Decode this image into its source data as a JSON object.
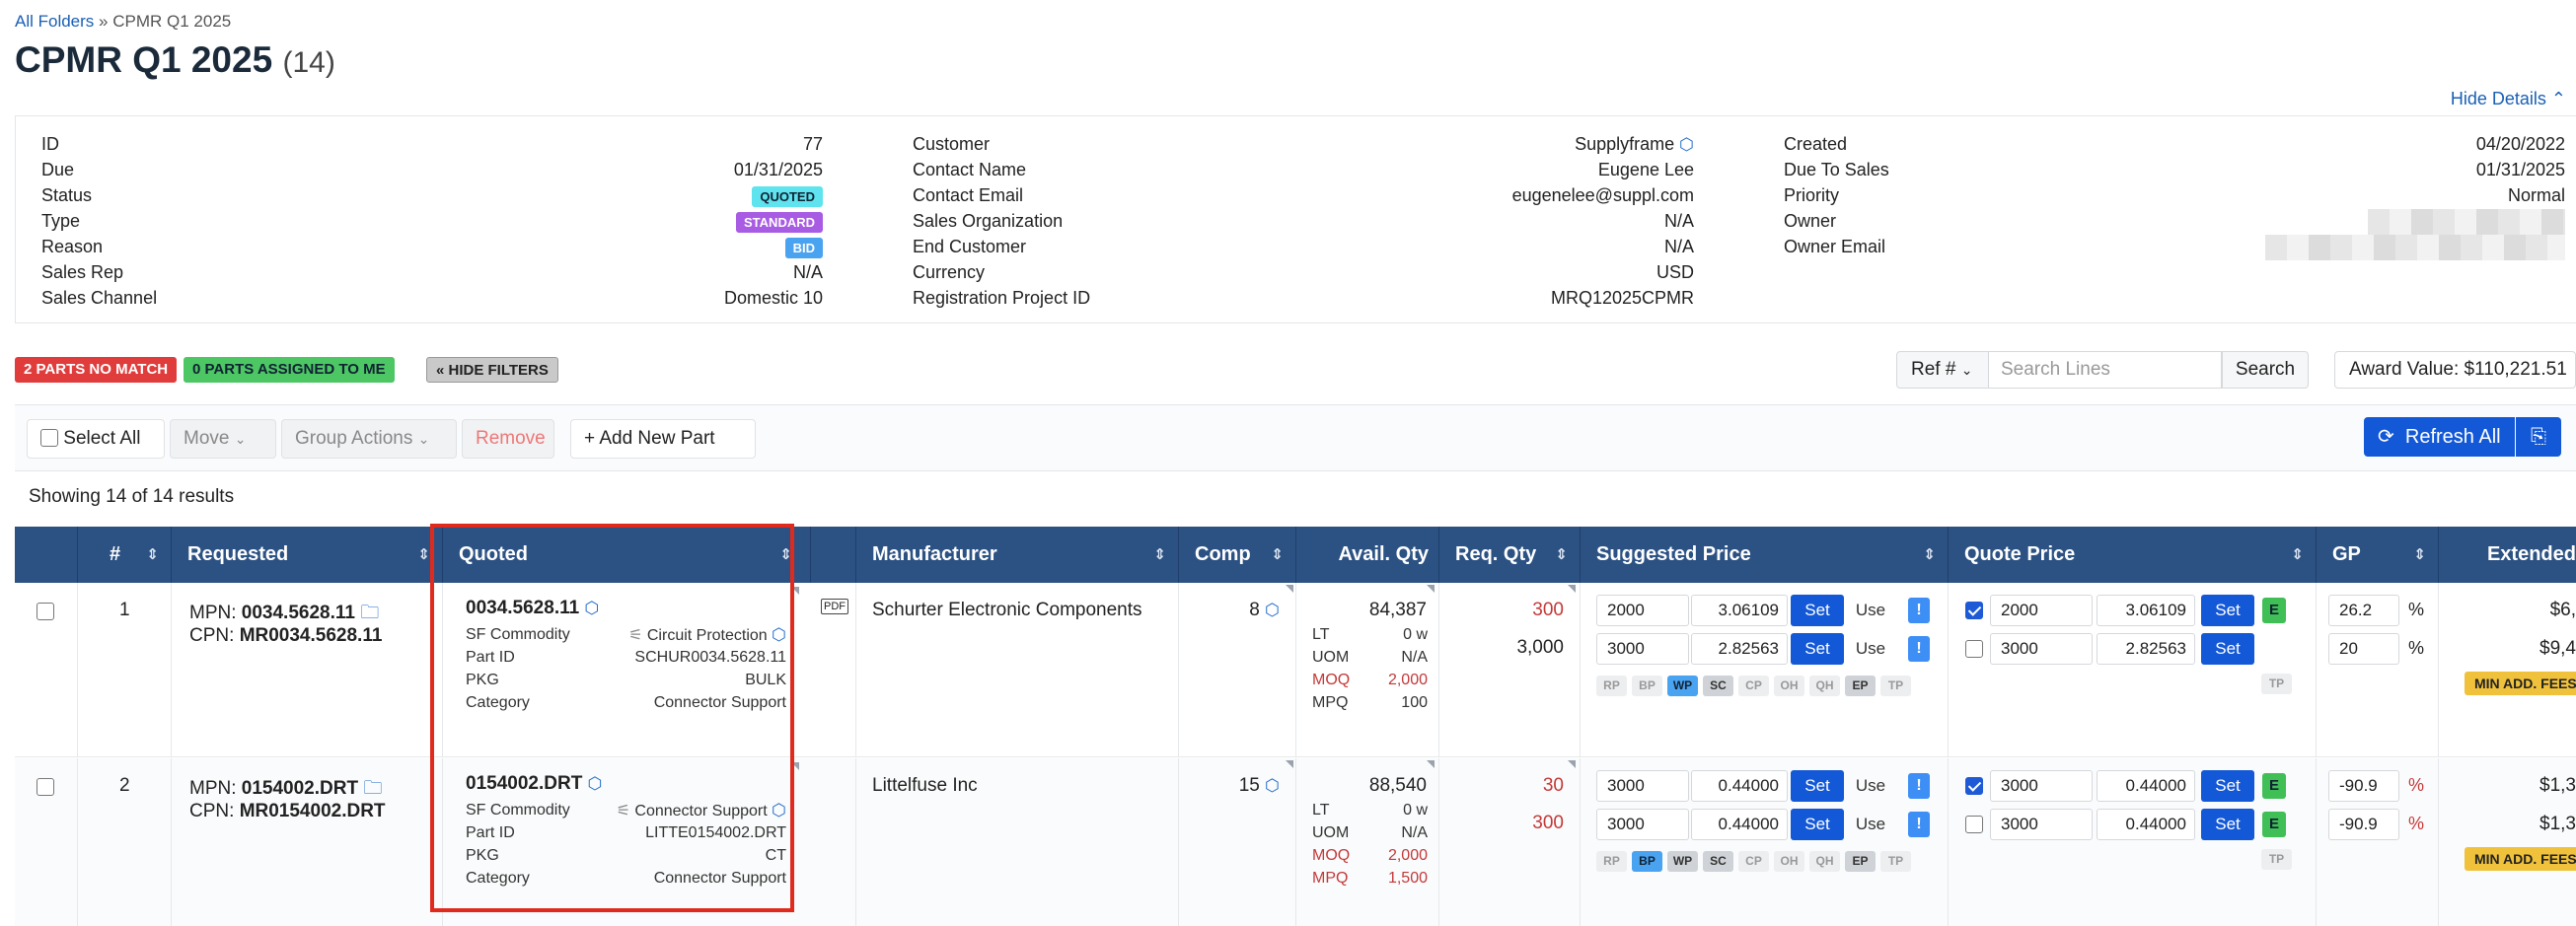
{
  "breadcrumb": {
    "root": "All Folders",
    "sep": "»",
    "current": "CPMR Q1 2025"
  },
  "page": {
    "title": "CPMR Q1 2025",
    "count": "(14)",
    "hide_details": "Hide Details"
  },
  "details": {
    "col1": [
      {
        "k": "ID",
        "v": "77"
      },
      {
        "k": "Due",
        "v": "01/31/2025"
      },
      {
        "k": "Status",
        "badge": "QUOTED"
      },
      {
        "k": "Type",
        "badge": "STANDARD"
      },
      {
        "k": "Reason",
        "badge": "BID"
      },
      {
        "k": "Sales Rep",
        "v": "N/A"
      },
      {
        "k": "Sales Channel",
        "v": "Domestic 10"
      }
    ],
    "col2": [
      {
        "k": "Customer",
        "v": "Supplyframe"
      },
      {
        "k": "Contact Name",
        "v": "Eugene Lee"
      },
      {
        "k": "Contact Email",
        "v": "eugenelee@suppl.com"
      },
      {
        "k": "Sales Organization",
        "v": "N/A"
      },
      {
        "k": "End Customer",
        "v": "N/A"
      },
      {
        "k": "Currency",
        "v": "USD"
      },
      {
        "k": "Registration Project ID",
        "v": "MRQ12025CPMR"
      }
    ],
    "col3": [
      {
        "k": "Created",
        "v": "04/20/2022"
      },
      {
        "k": "Due To Sales",
        "v": "01/31/2025"
      },
      {
        "k": "Priority",
        "v": "Normal"
      },
      {
        "k": "Owner",
        "v": ""
      },
      {
        "k": "Owner Email",
        "v": ""
      }
    ]
  },
  "filters": {
    "no_match": "2 PARTS NO MATCH",
    "assigned": "0 PARTS ASSIGNED TO ME",
    "hide_filters": "« HIDE FILTERS"
  },
  "search": {
    "ref_select": "Ref #",
    "placeholder": "Search Lines",
    "button": "Search",
    "award": "Award Value: $110,221.51"
  },
  "toolbar": {
    "select_all": "Select All",
    "move": "Move",
    "group_actions": "Group Actions",
    "remove": "Remove",
    "add_part": "+ Add New Part",
    "refresh_all": "Refresh All"
  },
  "results": "Showing 14 of 14 results",
  "columns": [
    "#",
    "Requested",
    "Quoted",
    "Manufacturer",
    "Comp",
    "Avail. Qty",
    "Req. Qty",
    "Suggested Price",
    "Quote Price",
    "GP",
    "Extended"
  ],
  "rows": [
    {
      "num": "1",
      "mpn_label": "MPN:",
      "mpn": "0034.5628.11",
      "cpn_label": "CPN:",
      "cpn": "MR0034.5628.11",
      "quoted": {
        "part": "0034.5628.11",
        "sf_commodity_label": "SF Commodity",
        "sf_commodity": "Circuit Protection",
        "part_id_label": "Part ID",
        "part_id": "SCHUR0034.5628.11",
        "pkg_label": "PKG",
        "pkg": "BULK",
        "category_label": "Category",
        "category": "Connector Support"
      },
      "manufacturer": "Schurter Electronic Components",
      "comp": "8",
      "avail": {
        "qty": "84,387",
        "lt": "0 w",
        "uom": "N/A",
        "moq": "2,000",
        "mpq": "100"
      },
      "req": [
        "300",
        "3,000"
      ],
      "suggested": [
        {
          "qty": "2000",
          "price": "3.06109"
        },
        {
          "qty": "3000",
          "price": "2.82563"
        }
      ],
      "chips": [
        "RP",
        "BP",
        "WP",
        "SC",
        "CP",
        "OH",
        "QH",
        "EP",
        "TP"
      ],
      "quote": [
        {
          "checked": true,
          "qty": "2000",
          "price": "3.06109"
        },
        {
          "checked": false,
          "qty": "3000",
          "price": "2.82563"
        }
      ],
      "gp": [
        "26.2",
        "20"
      ],
      "extended": [
        "$6,",
        "$9,4"
      ],
      "min_fees": "MIN ADD. FEES"
    },
    {
      "num": "2",
      "mpn_label": "MPN:",
      "mpn": "0154002.DRT",
      "cpn_label": "CPN:",
      "cpn": "MR0154002.DRT",
      "quoted": {
        "part": "0154002.DRT",
        "sf_commodity_label": "SF Commodity",
        "sf_commodity": "Connector Support",
        "part_id_label": "Part ID",
        "part_id": "LITTE0154002.DRT",
        "pkg_label": "PKG",
        "pkg": "CT",
        "category_label": "Category",
        "category": "Connector Support"
      },
      "manufacturer": "Littelfuse Inc",
      "comp": "15",
      "avail": {
        "qty": "88,540",
        "lt": "0 w",
        "uom": "N/A",
        "moq": "2,000",
        "mpq": "1,500"
      },
      "req": [
        "30",
        "300"
      ],
      "suggested": [
        {
          "qty": "3000",
          "price": "0.44000"
        },
        {
          "qty": "3000",
          "price": "0.44000"
        }
      ],
      "chips": [
        "RP",
        "BP",
        "WP",
        "SC",
        "CP",
        "OH",
        "QH",
        "EP",
        "TP"
      ],
      "quote": [
        {
          "checked": true,
          "qty": "3000",
          "price": "0.44000"
        },
        {
          "checked": false,
          "qty": "3000",
          "price": "0.44000"
        }
      ],
      "gp": [
        "-90.9",
        "-90.9"
      ],
      "extended": [
        "$1,3",
        "$1,3"
      ],
      "min_fees": "MIN ADD. FEES"
    }
  ],
  "labels": {
    "lt": "LT",
    "uom": "UOM",
    "moq": "MOQ",
    "mpq": "MPQ",
    "set": "Set",
    "use": "Use",
    "exc": "!",
    "e": "E",
    "pct": "%"
  },
  "colors": {
    "header": "#2c5283",
    "primary": "#1358d6",
    "highlight": "#e02a1d"
  }
}
